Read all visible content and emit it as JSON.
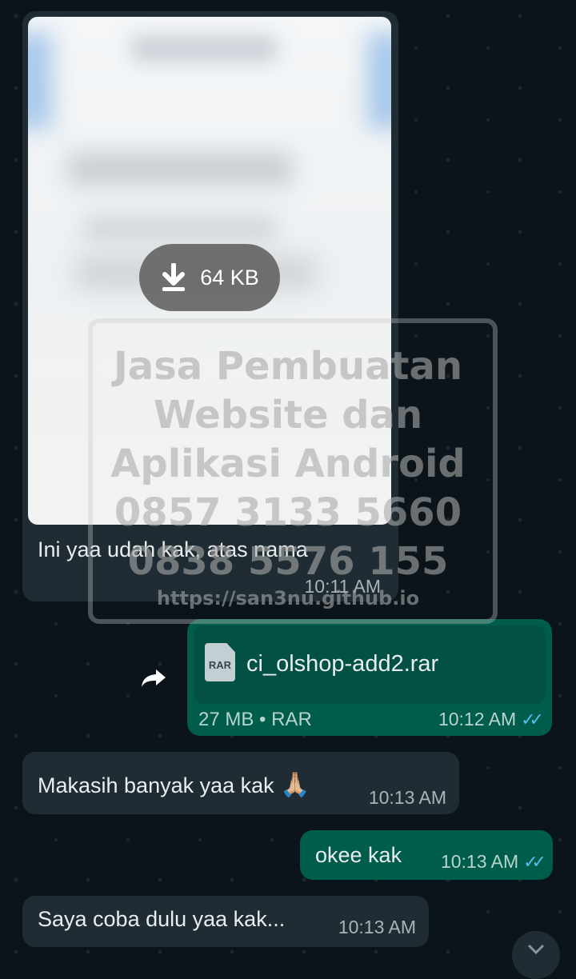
{
  "messages": {
    "image": {
      "download_size": "64 KB",
      "caption": "Ini yaa udah kak, atas nama",
      "time": "10:11 AM"
    },
    "file": {
      "filename": "ci_olshop-add2.rar",
      "type_badge": "RAR",
      "meta": "27 MB • RAR",
      "time": "10:12 AM"
    },
    "m1": {
      "text": "Makasih banyak yaa kak",
      "emoji": "🙏🏼",
      "time": "10:13 AM"
    },
    "m2": {
      "text": "okee kak",
      "time": "10:13 AM"
    },
    "m3": {
      "text": "Saya coba dulu yaa kak...",
      "time": "10:13 AM"
    }
  },
  "watermark": {
    "line1": "Jasa Pembuatan",
    "line2": "Website dan",
    "line3": "Aplikasi Android",
    "line4": "0857 3133 5660",
    "line5": "0838 5576 155",
    "line6": "https://san3nu.github.io"
  },
  "icons": {
    "download": "download-arrow-icon",
    "forward": "forward-arrow-icon",
    "file": "rar-file-icon",
    "read_ticks": "double-check-icon",
    "scroll_down": "chevron-down-icon"
  },
  "colors": {
    "background": "#0b141a",
    "incoming": "#202c33",
    "outgoing": "#005c4b",
    "read_ticks": "#53bdeb"
  }
}
